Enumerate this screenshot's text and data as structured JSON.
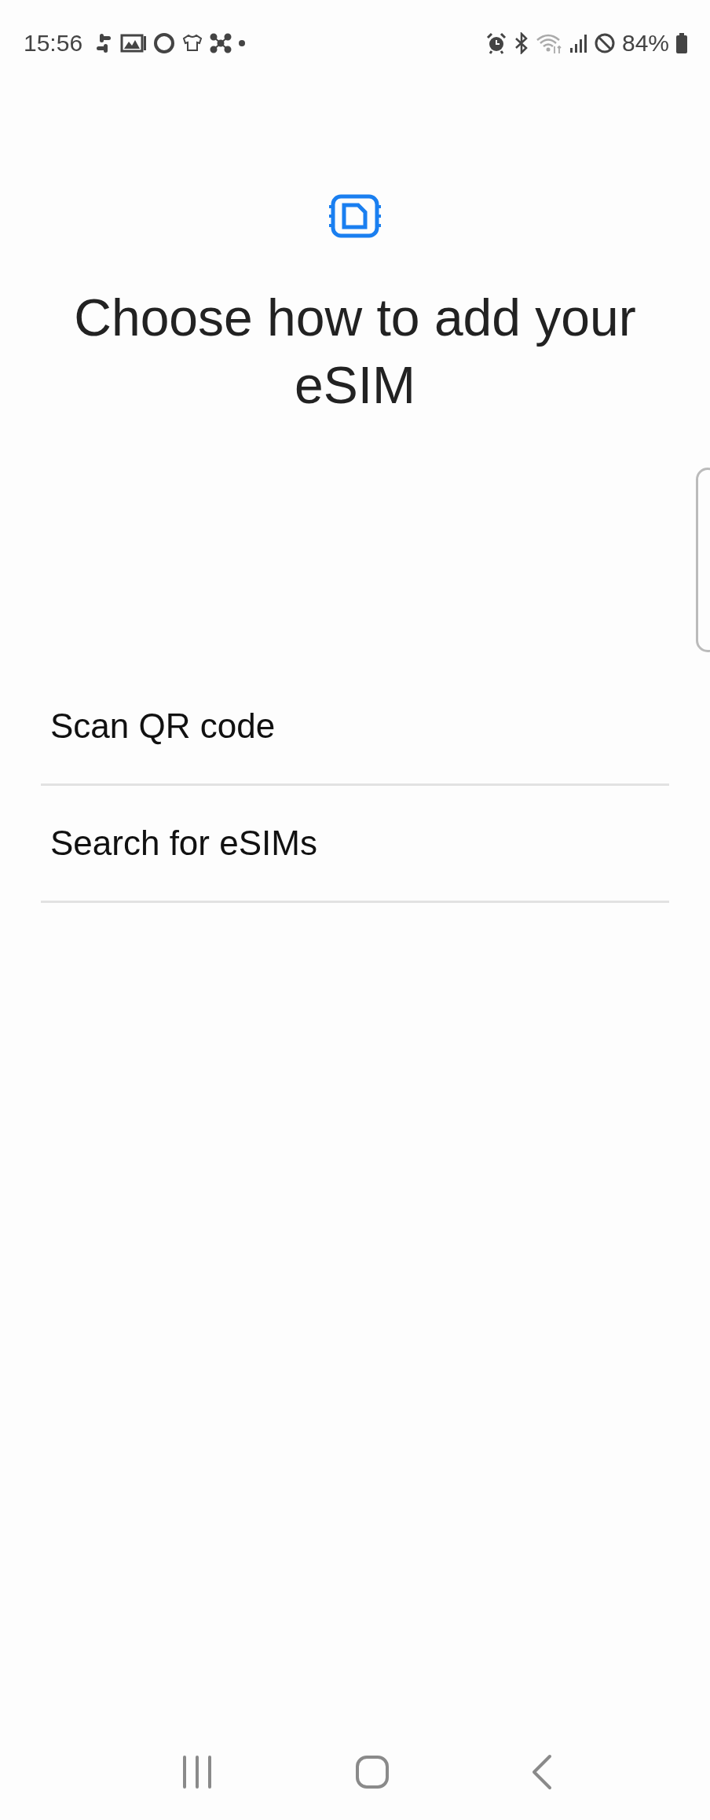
{
  "status_bar": {
    "time": "15:56",
    "battery": "84%"
  },
  "title": "Choose how to add your eSIM",
  "options": [
    {
      "label": "Scan QR code"
    },
    {
      "label": "Search for eSIMs"
    }
  ]
}
